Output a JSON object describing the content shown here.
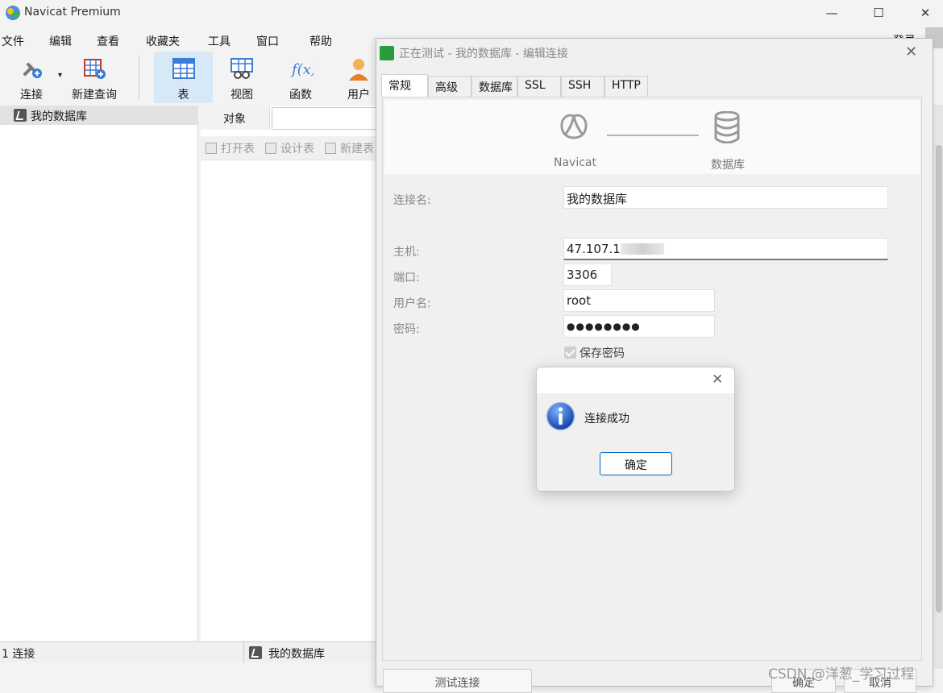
{
  "app": {
    "title": "Navicat Premium",
    "login": "登录"
  },
  "menu": [
    "文件",
    "编辑",
    "查看",
    "收藏夹",
    "工具",
    "窗口",
    "帮助"
  ],
  "toolbar": {
    "connect": "连接",
    "new_query": "新建查询",
    "table": "表",
    "view": "视图",
    "function": "函数",
    "user": "用户"
  },
  "tree": {
    "connection": "我的数据库"
  },
  "objects": {
    "tab": "对象",
    "open_table": "打开表",
    "design_table": "设计表",
    "new_table": "新建表"
  },
  "status": {
    "left": "1 连接",
    "right": "我的数据库"
  },
  "dialog": {
    "title": "正在测试 - 我的数据库 - 编辑连接",
    "tabs": [
      "常规",
      "高级",
      "数据库",
      "SSL",
      "SSH",
      "HTTP"
    ],
    "banner_left": "Navicat",
    "banner_right": "数据库",
    "labels": {
      "conn_name": "连接名:",
      "host": "主机:",
      "port": "端口:",
      "username": "用户名:",
      "password": "密码:"
    },
    "values": {
      "conn_name": "我的数据库",
      "host": "47.107.1",
      "port": "3306",
      "username": "root",
      "password": "●●●●●●●●"
    },
    "save_password": "保存密码",
    "test_button": "测试连接",
    "ok_button": "确定",
    "cancel_button": "取消"
  },
  "message": {
    "text": "连接成功",
    "ok": "确定"
  },
  "watermark": "CSDN @洋葱_学习过程",
  "colors": {
    "accent": "#0067c0",
    "active_tool": "#d7e8f7",
    "logo_green": "#2a9d3a"
  }
}
